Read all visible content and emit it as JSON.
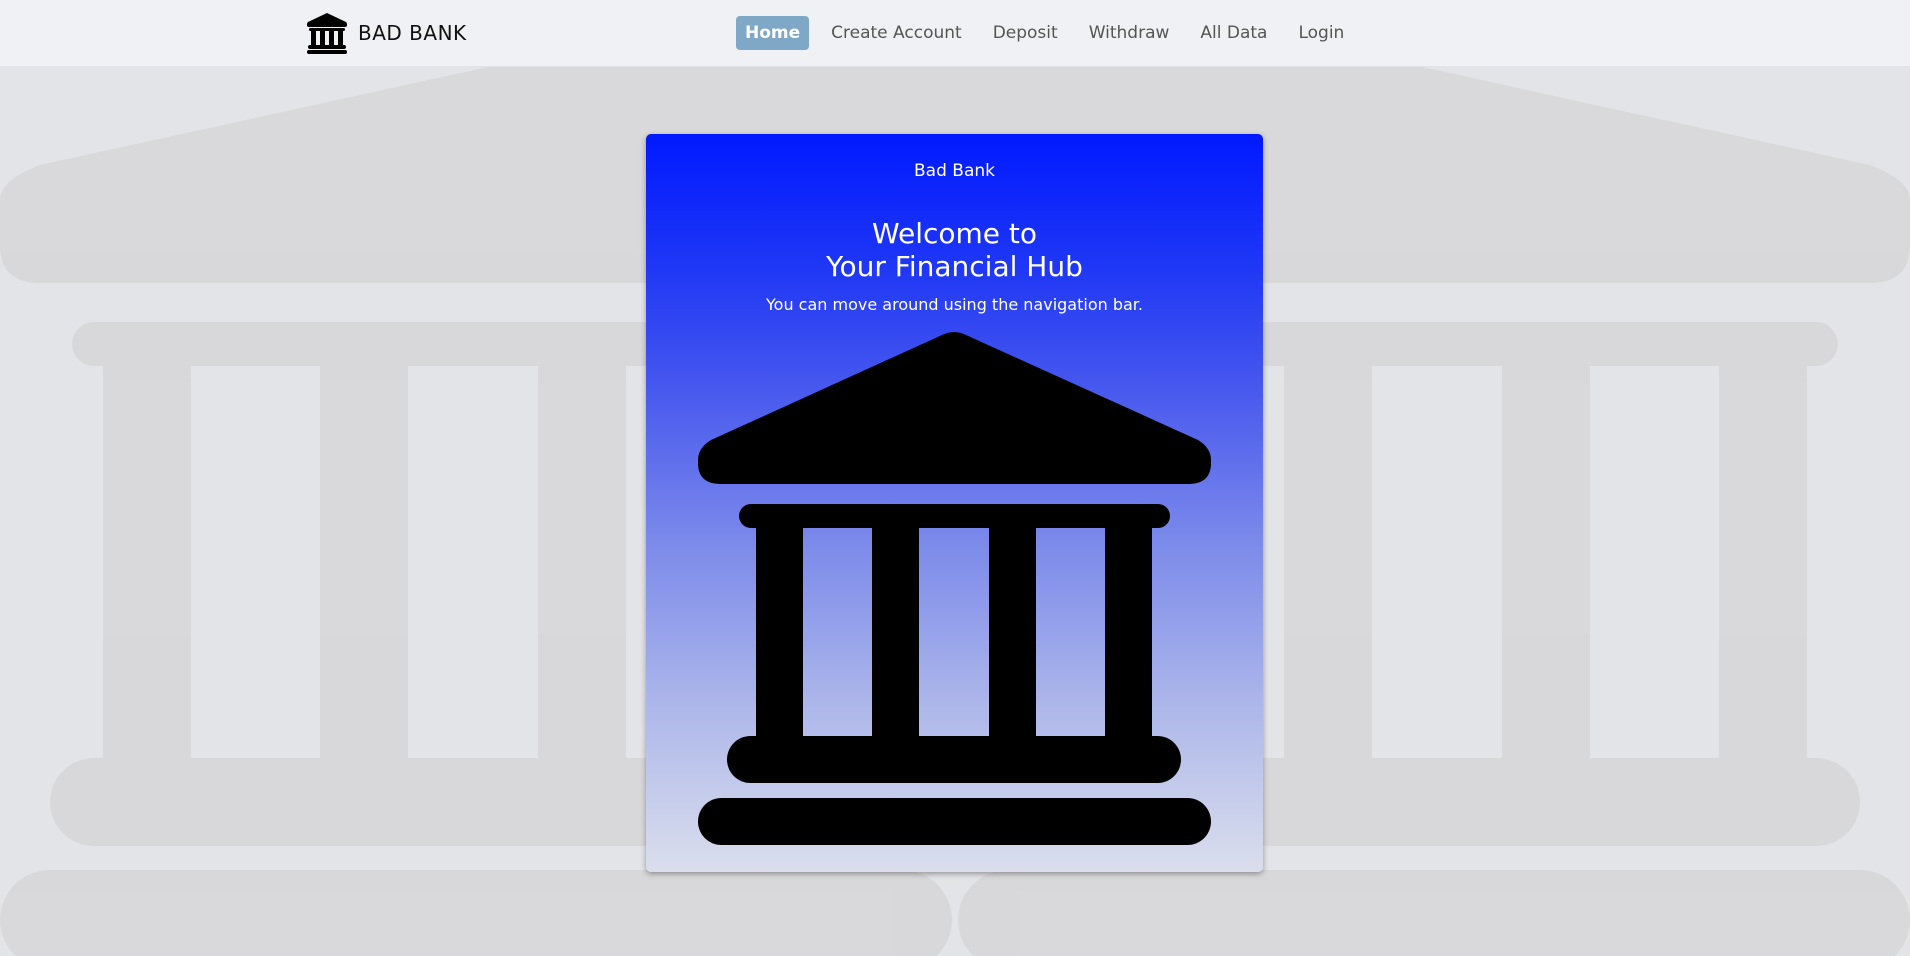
{
  "navbar": {
    "brand_icon": "bank-icon",
    "brand_text": "BAD BANK",
    "items": [
      {
        "label": "Home",
        "active": true
      },
      {
        "label": "Create Account",
        "active": false
      },
      {
        "label": "Deposit",
        "active": false
      },
      {
        "label": "Withdraw",
        "active": false
      },
      {
        "label": "All Data",
        "active": false
      },
      {
        "label": "Login",
        "active": false
      }
    ],
    "active_color": "#7fa8c6"
  },
  "card": {
    "header": "Bad Bank",
    "title_line1": "Welcome to",
    "title_line2": "Your Financial Hub",
    "text": "You can move around using the navigation bar.",
    "image_icon": "bank-icon",
    "gradient_top": "#0019ff",
    "gradient_bottom": "#dadeec"
  },
  "background": {
    "image_icon": "bank-icon",
    "color": "#e3e4e7"
  }
}
